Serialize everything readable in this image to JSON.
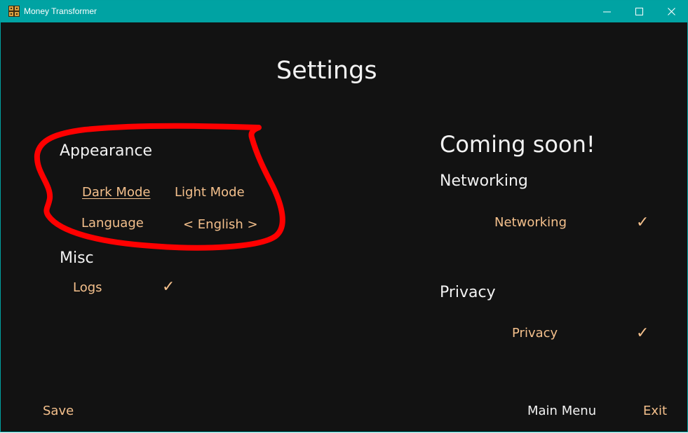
{
  "window": {
    "title": "Money Transformer",
    "controls": {
      "minimize": "minimize",
      "maximize": "maximize",
      "close": "close"
    }
  },
  "page": {
    "heading": "Settings"
  },
  "appearance": {
    "heading": "Appearance",
    "dark_mode": "Dark Mode",
    "light_mode": "Light Mode",
    "language_label": "Language",
    "language_value": "< English >"
  },
  "misc": {
    "heading": "Misc",
    "logs_label": "Logs",
    "logs_check": "✓"
  },
  "coming_soon": {
    "heading": "Coming soon!",
    "networking_heading": "Networking",
    "networking_label": "Networking",
    "networking_check": "✓",
    "privacy_heading": "Privacy",
    "privacy_label": "Privacy",
    "privacy_check": "✓"
  },
  "footer": {
    "save": "Save",
    "main_menu": "Main Menu",
    "exit": "Exit"
  },
  "colors": {
    "titlebar": "#00a3a3",
    "background": "#121212",
    "text_white": "#f2f2f2",
    "text_accent": "#f4c08c",
    "annotation": "#ff0000"
  }
}
